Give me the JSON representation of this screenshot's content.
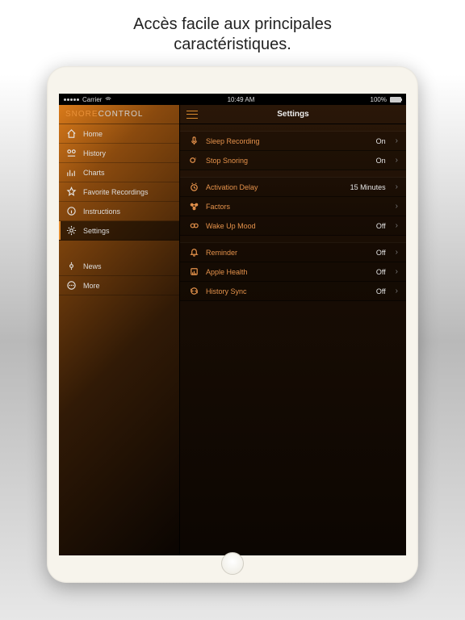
{
  "promo": {
    "line1": "Accès facile aux principales",
    "line2": "caractéristiques."
  },
  "statusbar": {
    "carrier": "Carrier",
    "time": "10:49 AM",
    "battery": "100%"
  },
  "brand": {
    "part1": "SNORE",
    "part2": "CONTROL"
  },
  "sidebar": {
    "items": [
      {
        "label": "Home",
        "icon": "home-icon"
      },
      {
        "label": "History",
        "icon": "history-icon"
      },
      {
        "label": "Charts",
        "icon": "charts-icon"
      },
      {
        "label": "Favorite Recordings",
        "icon": "star-icon"
      },
      {
        "label": "Instructions",
        "icon": "info-icon"
      },
      {
        "label": "Settings",
        "icon": "gear-icon",
        "selected": true
      }
    ],
    "more": [
      {
        "label": "News",
        "icon": "news-icon"
      },
      {
        "label": "More",
        "icon": "more-icon"
      }
    ]
  },
  "content": {
    "title": "Settings",
    "groups": [
      [
        {
          "label": "Sleep Recording",
          "value": "On",
          "icon": "mic-icon"
        },
        {
          "label": "Stop Snoring",
          "value": "On",
          "icon": "zzz-icon"
        }
      ],
      [
        {
          "label": "Activation Delay",
          "value": "15 Minutes",
          "icon": "clock-icon"
        },
        {
          "label": "Factors",
          "value": "",
          "icon": "factors-icon"
        },
        {
          "label": "Wake Up Mood",
          "value": "Off",
          "icon": "mood-icon"
        }
      ],
      [
        {
          "label": "Reminder",
          "value": "Off",
          "icon": "bell-icon"
        },
        {
          "label": "Apple Health",
          "value": "Off",
          "icon": "health-icon"
        },
        {
          "label": "History Sync",
          "value": "Off",
          "icon": "sync-icon"
        }
      ]
    ]
  }
}
